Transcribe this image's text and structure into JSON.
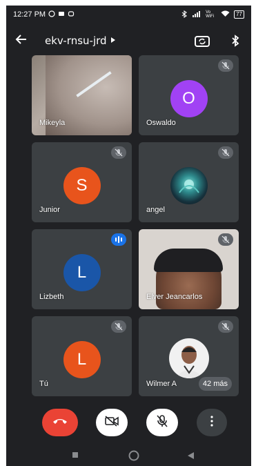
{
  "status_bar": {
    "time": "12:27 PM",
    "left_icons": [
      "whatsapp-icon",
      "message-icon",
      "notification-icon"
    ],
    "right_icons": [
      "bluetooth-icon",
      "signal-icon",
      "wifi-icon"
    ],
    "volte": "Vo WiFi",
    "battery": "77"
  },
  "app_bar": {
    "meeting_code": "ekv-rnsu-jrd",
    "back_icon": "arrow-back-icon",
    "caret_icon": "caret-right-icon",
    "icons": [
      "switch-camera-icon",
      "bluetooth-audio-icon"
    ]
  },
  "participants": [
    {
      "name": "Mikeyla",
      "type": "video",
      "muted": false
    },
    {
      "name": "Oswaldo",
      "type": "avatar",
      "initial": "O",
      "color": "#a142f4",
      "muted": true
    },
    {
      "name": "Junior",
      "type": "avatar",
      "initial": "S",
      "color": "#e8541c",
      "muted": true
    },
    {
      "name": "angel",
      "type": "photo",
      "muted": true
    },
    {
      "name": "Lizbeth",
      "type": "avatar",
      "initial": "L",
      "color": "#1a56a8",
      "speaking": true
    },
    {
      "name": "Elver Jeancarlos",
      "type": "video",
      "muted": true
    },
    {
      "name": "Tú",
      "type": "avatar",
      "initial": "L",
      "color": "#e8541c",
      "muted": true
    },
    {
      "name": "Wilmer A",
      "type": "photo",
      "muted": true,
      "more_label": "42 más"
    }
  ],
  "controls": [
    {
      "name": "end-call",
      "icon": "call-end-icon",
      "color": "#ea4335"
    },
    {
      "name": "camera-off",
      "icon": "video-off-icon",
      "color": "#ffffff"
    },
    {
      "name": "mic-off",
      "icon": "mic-off-icon",
      "color": "#ffffff"
    },
    {
      "name": "more-options",
      "icon": "more-vert-icon",
      "color": "#3c4043"
    }
  ],
  "nav_bar": [
    "recents-icon",
    "home-icon",
    "back-nav-icon"
  ],
  "colors": {
    "background": "#202124",
    "tile": "#3c4043",
    "accent_blue": "#1a73e8",
    "end_call_red": "#ea4335"
  }
}
